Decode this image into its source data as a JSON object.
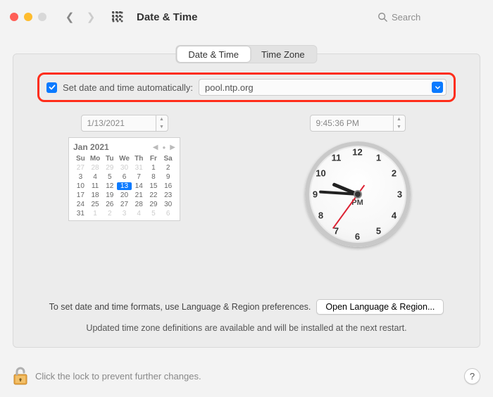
{
  "window": {
    "title": "Date & Time",
    "search_placeholder": "Search"
  },
  "tabs": {
    "date_time": "Date & Time",
    "time_zone": "Time Zone"
  },
  "auto": {
    "checked": true,
    "label": "Set date and time automatically:",
    "server": "pool.ntp.org"
  },
  "date": {
    "field": "1/13/2021",
    "cal_title": "Jan 2021",
    "dow": [
      "Su",
      "Mo",
      "Tu",
      "We",
      "Th",
      "Fr",
      "Sa"
    ],
    "prev_trailing": [
      27,
      28,
      29,
      30,
      31
    ],
    "days": [
      1,
      2,
      3,
      4,
      5,
      6,
      7,
      8,
      9,
      10,
      11,
      12,
      13,
      14,
      15,
      16,
      17,
      18,
      19,
      20,
      21,
      22,
      23,
      24,
      25,
      26,
      27,
      28,
      29,
      30,
      31
    ],
    "selected": 13,
    "next_leading": [
      1,
      2,
      3,
      4,
      5,
      6
    ]
  },
  "time": {
    "field": "9:45:36 PM",
    "ampm": "PM",
    "hour": 9,
    "minute": 45,
    "second": 36
  },
  "footer": {
    "format_hint": "To set date and time formats, use Language & Region preferences.",
    "open_lang_btn": "Open Language & Region...",
    "update_note": "Updated time zone definitions are available and will be installed at the next restart."
  },
  "lock": {
    "text": "Click the lock to prevent further changes.",
    "help": "?"
  },
  "clock_numbers": [
    "12",
    "1",
    "2",
    "3",
    "4",
    "5",
    "6",
    "7",
    "8",
    "9",
    "10",
    "11"
  ]
}
